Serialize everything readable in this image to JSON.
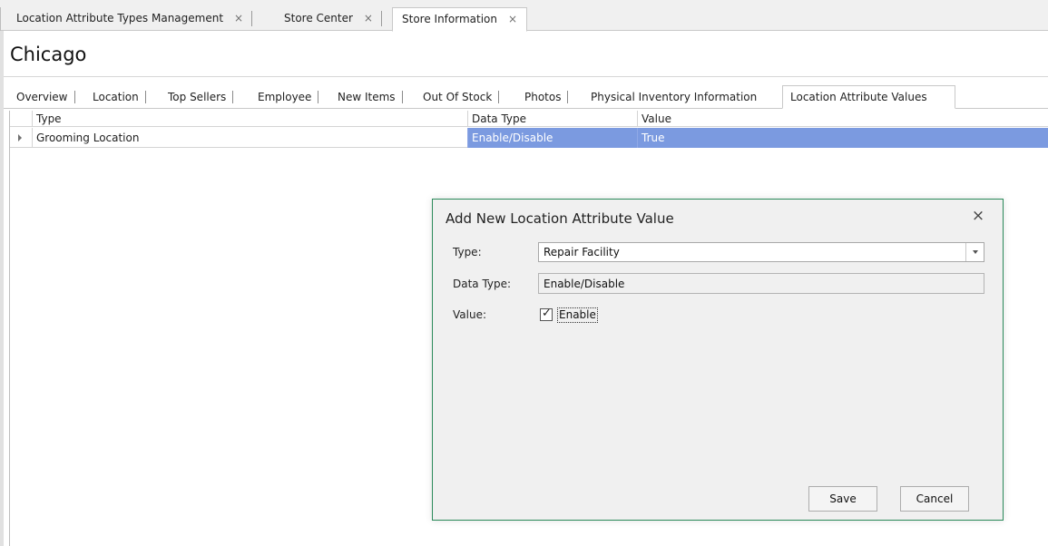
{
  "doc_tabs": [
    {
      "label": "Location Attribute Types Management",
      "close": "×"
    },
    {
      "label": "Store Center",
      "close": "×"
    },
    {
      "label": "Store Information",
      "close": "×"
    }
  ],
  "page": {
    "title": "Chicago"
  },
  "inner_tabs": [
    "Overview",
    "Location",
    "Top Sellers",
    "Employee",
    "New Items",
    "Out Of Stock",
    "Photos",
    "Physical Inventory Information",
    "Location Attribute Values"
  ],
  "grid": {
    "columns": [
      "Type",
      "Data Type",
      "Value"
    ],
    "rows": [
      {
        "type": "Grooming Location",
        "data_type": "Enable/Disable",
        "value": "True"
      }
    ]
  },
  "dialog": {
    "title": "Add New Location Attribute Value",
    "close": "×",
    "type_label": "Type:",
    "type_value": "Repair Facility",
    "data_type_label": "Data Type:",
    "data_type_value": "Enable/Disable",
    "value_label": "Value:",
    "checkbox_mark": "✓",
    "checkbox_label": "Enable",
    "checkbox_checked": true,
    "save": "Save",
    "cancel": "Cancel"
  },
  "colors": {
    "selection": "#7b9ae0",
    "dialog_border": "#2a8a5a"
  }
}
